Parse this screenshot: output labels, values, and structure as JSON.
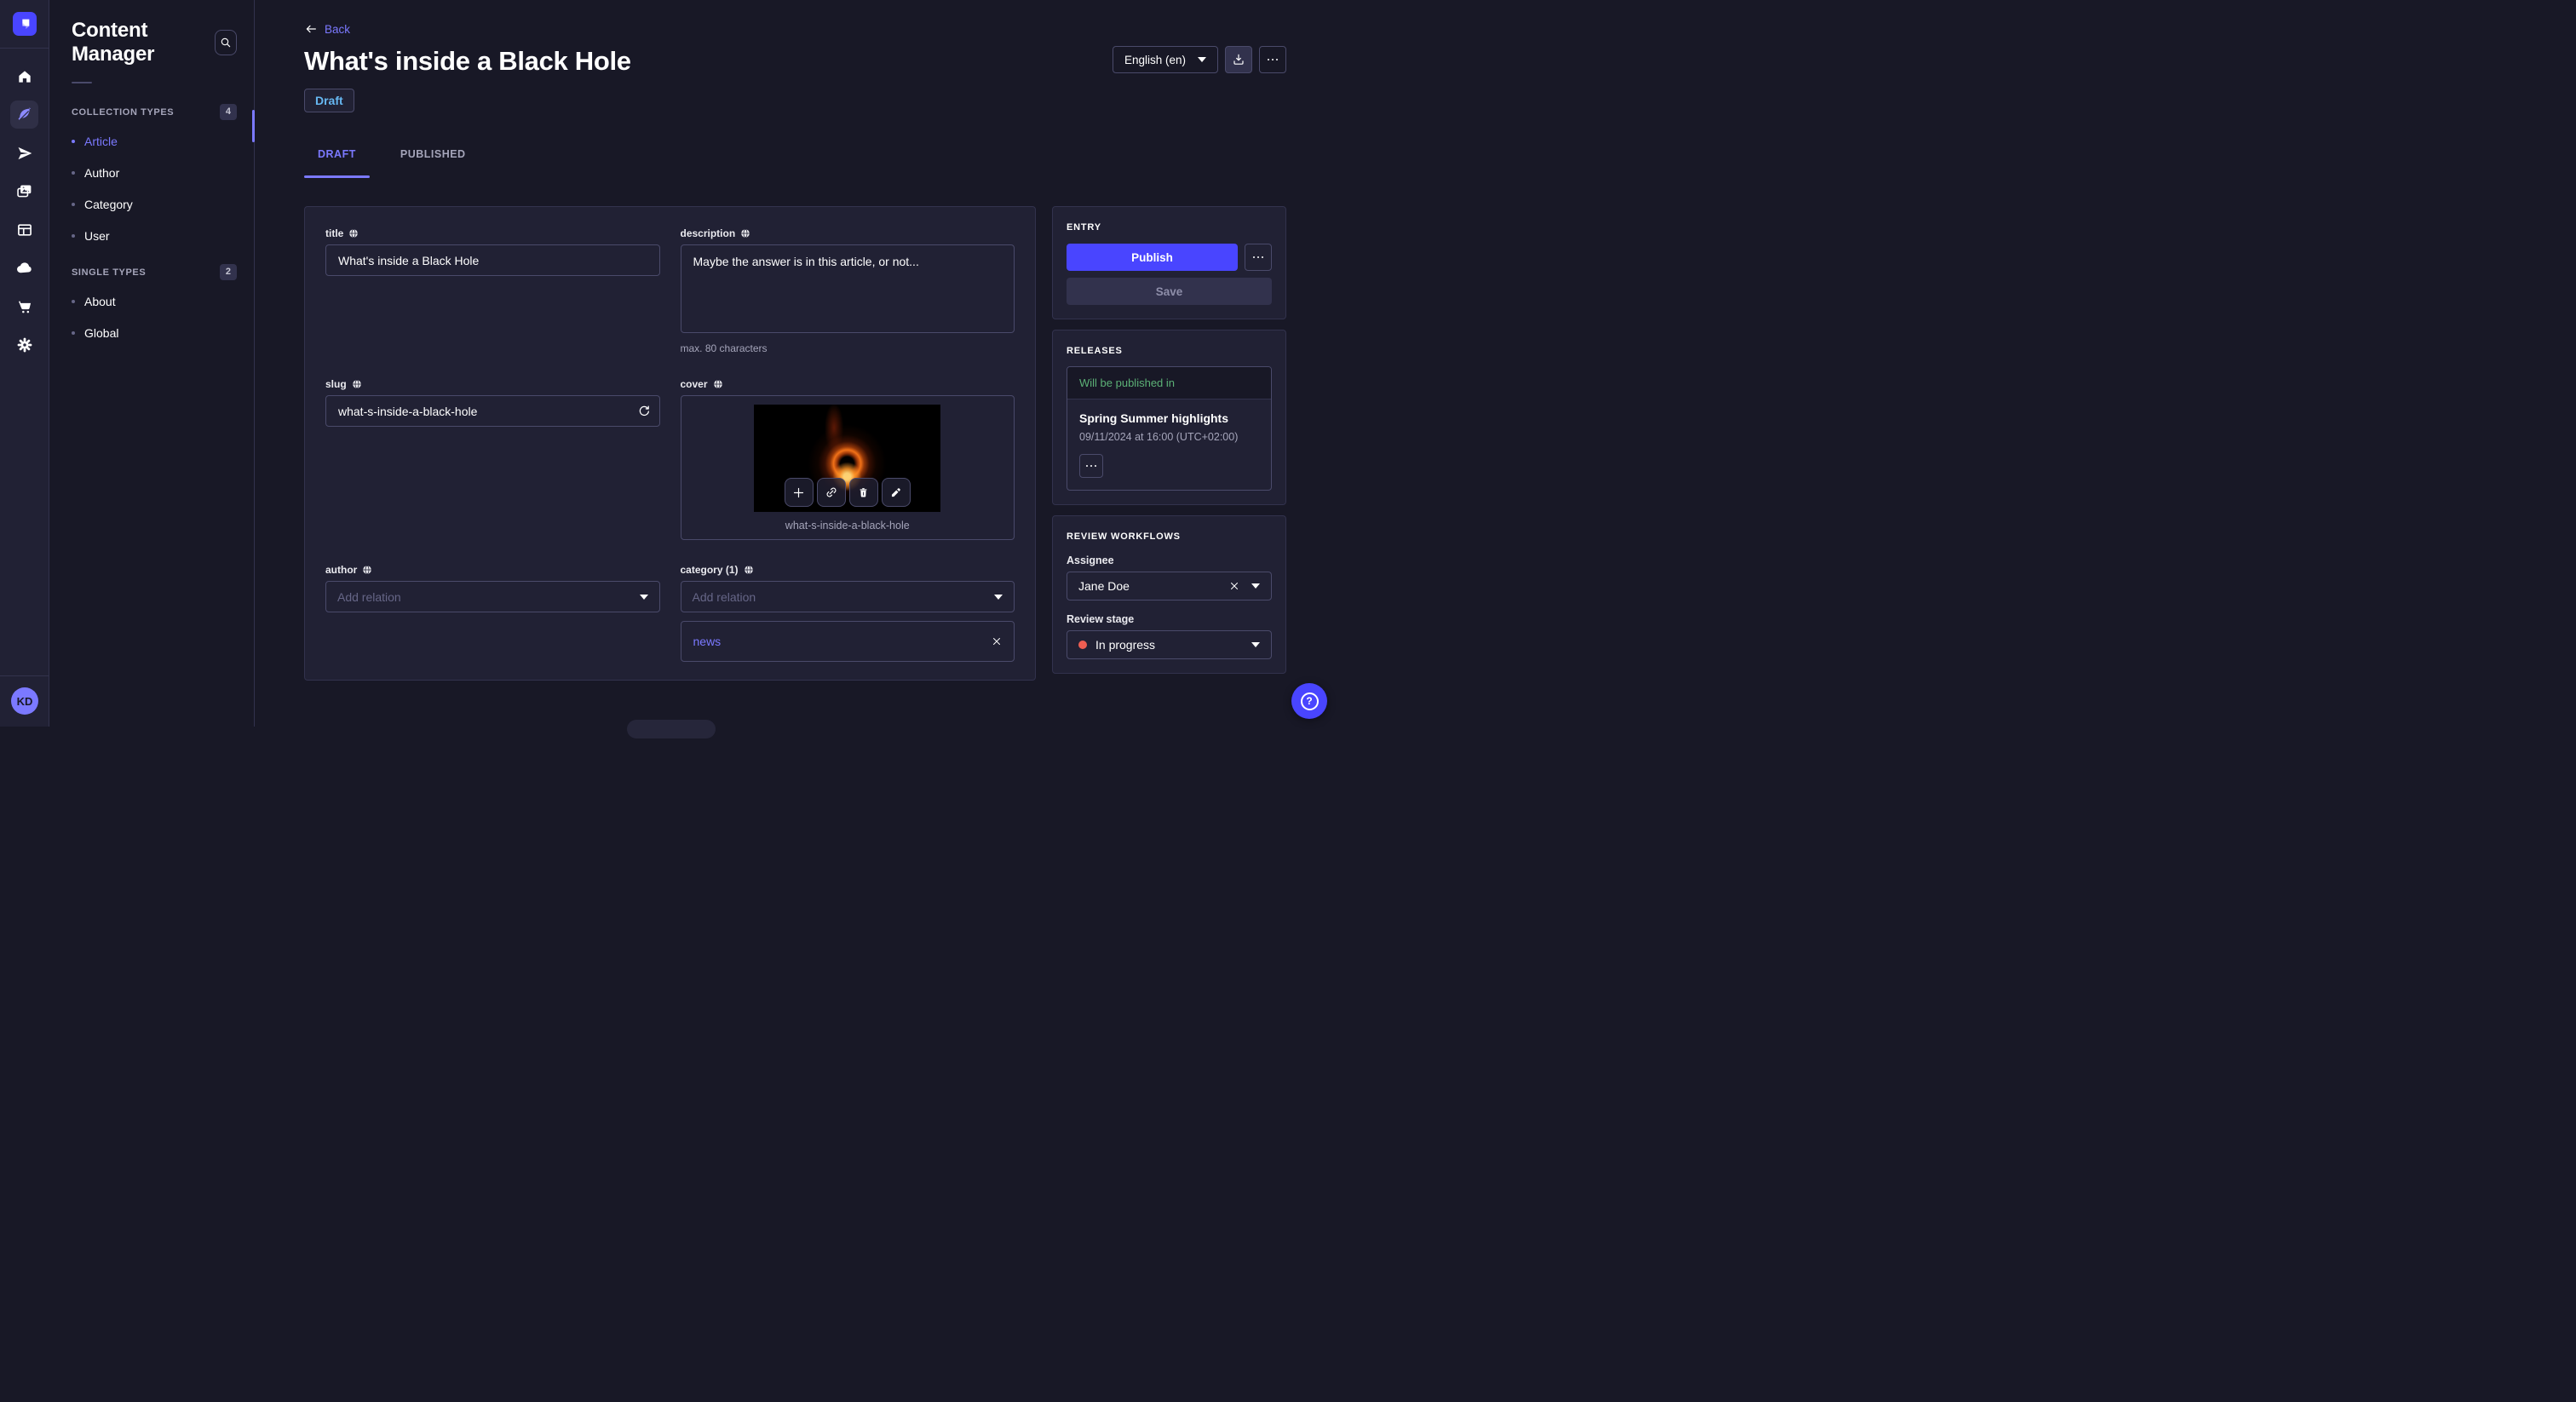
{
  "app": {
    "rail_icons": [
      "home",
      "content-manager",
      "releases",
      "media-library",
      "content-type-builder",
      "deploy",
      "marketplace",
      "settings"
    ],
    "avatar_initials": "KD"
  },
  "subnav": {
    "title": "Content Manager",
    "sections": [
      {
        "label": "COLLECTION TYPES",
        "count": "4",
        "items": [
          {
            "label": "Article",
            "active": true
          },
          {
            "label": "Author"
          },
          {
            "label": "Category"
          },
          {
            "label": "User"
          }
        ]
      },
      {
        "label": "SINGLE TYPES",
        "count": "2",
        "items": [
          {
            "label": "About"
          },
          {
            "label": "Global"
          }
        ]
      }
    ]
  },
  "header": {
    "back": "Back",
    "title": "What's inside a Black Hole",
    "status_badge": "Draft",
    "locale": "English (en)"
  },
  "tabs": {
    "draft": "DRAFT",
    "published": "PUBLISHED"
  },
  "form": {
    "title": {
      "label": "title",
      "value": "What's inside a Black Hole"
    },
    "description": {
      "label": "description",
      "value": "Maybe the answer is in this article, or not...",
      "helper": "max. 80 characters"
    },
    "slug": {
      "label": "slug",
      "value": "what-s-inside-a-black-hole"
    },
    "cover": {
      "label": "cover",
      "filename": "what-s-inside-a-black-hole",
      "actions": [
        "add",
        "link",
        "delete",
        "edit"
      ]
    },
    "author": {
      "label": "author",
      "placeholder": "Add relation"
    },
    "category": {
      "label": "category (1)",
      "placeholder": "Add relation",
      "selected": [
        {
          "name": "news"
        }
      ]
    }
  },
  "entry_panel": {
    "header": "ENTRY",
    "publish": "Publish",
    "save": "Save"
  },
  "releases_panel": {
    "header": "RELEASES",
    "banner": "Will be published in",
    "release_name": "Spring Summer highlights",
    "release_date": "09/11/2024 at 16:00 (UTC+02:00)"
  },
  "review_panel": {
    "header": "REVIEW WORKFLOWS",
    "assignee_label": "Assignee",
    "assignee": "Jane Doe",
    "stage_label": "Review stage",
    "stage": "In progress"
  },
  "colors": {
    "primary": "#4945ff",
    "primary_light": "#7b79ff",
    "draft_blue": "#66b7f1",
    "success_green": "#5cb176",
    "stage_red": "#ee5e52",
    "card_bg": "#212134",
    "app_bg": "#181826",
    "border": "#32324d",
    "input_border": "#4a4a6a"
  }
}
